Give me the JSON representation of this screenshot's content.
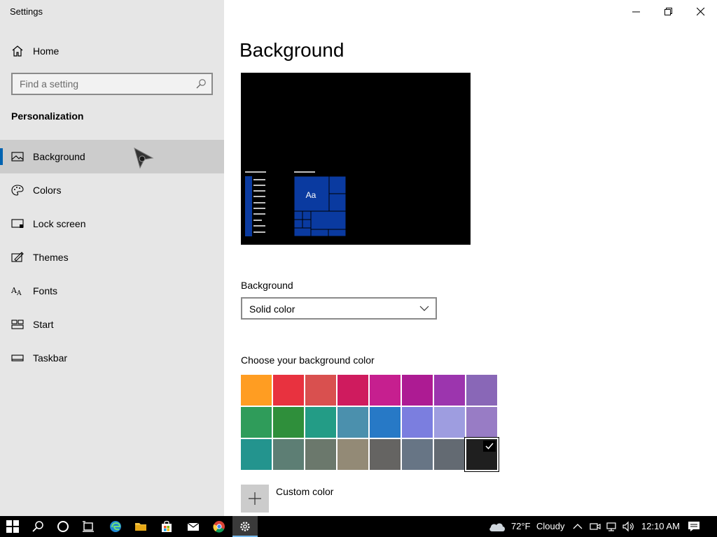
{
  "window": {
    "title": "Settings"
  },
  "sidebar": {
    "home_label": "Home",
    "search_placeholder": "Find a setting",
    "section_title": "Personalization",
    "items": [
      {
        "label": "Background",
        "icon": "picture-icon",
        "active": true
      },
      {
        "label": "Colors",
        "icon": "palette-icon"
      },
      {
        "label": "Lock screen",
        "icon": "lock-screen-icon"
      },
      {
        "label": "Themes",
        "icon": "themes-icon"
      },
      {
        "label": "Fonts",
        "icon": "fonts-icon"
      },
      {
        "label": "Start",
        "icon": "start-icon"
      },
      {
        "label": "Taskbar",
        "icon": "taskbar-icon"
      }
    ]
  },
  "main": {
    "title": "Background",
    "preview": {
      "tile_text": "Aa"
    },
    "background_label": "Background",
    "background_value": "Solid color",
    "color_label": "Choose your background color",
    "colors": [
      [
        "#ff9d22",
        "#e8323f",
        "#d9504f",
        "#cf1b5e",
        "#c61f8f",
        "#ad1b93",
        "#9c35ae",
        "#8967b7"
      ],
      [
        "#2f9c5a",
        "#2f8f3b",
        "#239c86",
        "#4b90ad",
        "#2779c6",
        "#7b7edf",
        "#9e9de0",
        "#987cc5"
      ],
      [
        "#23948e",
        "#5d7e74",
        "#6b786c",
        "#938a76",
        "#656462",
        "#677585",
        "#636a72",
        "#1f1f1f"
      ]
    ],
    "selected_color": "#1f1f1f",
    "custom_color_label": "Custom color"
  },
  "taskbar": {
    "weather": "72°F",
    "condition": "Cloudy",
    "time": "12:10 AM"
  }
}
